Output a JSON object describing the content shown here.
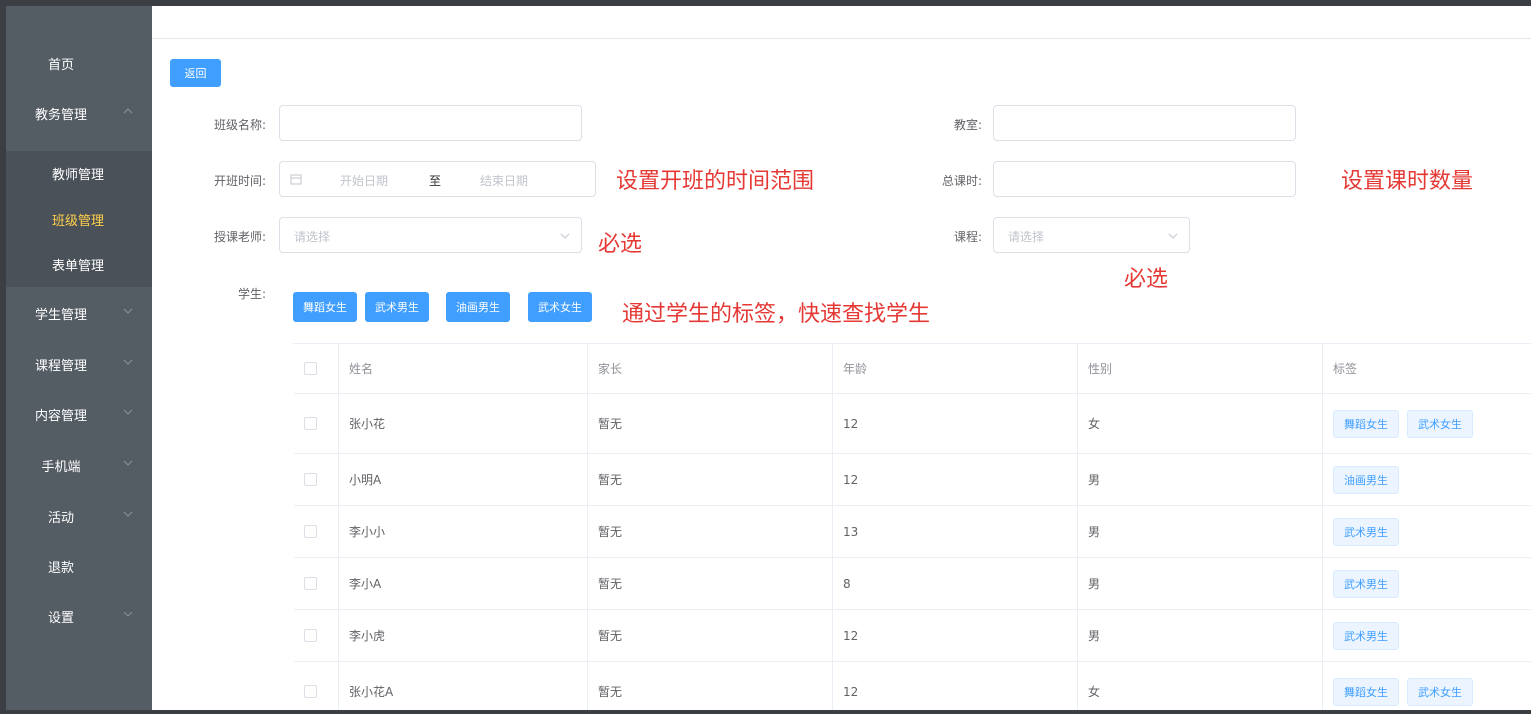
{
  "sidebar": {
    "items": [
      {
        "label": "首页",
        "chevron": false
      },
      {
        "label": "教务管理",
        "chevron": true,
        "expanded": true
      },
      {
        "label": "学生管理",
        "chevron": true
      },
      {
        "label": "课程管理",
        "chevron": true
      },
      {
        "label": "内容管理",
        "chevron": true
      },
      {
        "label": "手机端",
        "chevron": true
      },
      {
        "label": "活动",
        "chevron": true
      },
      {
        "label": "退款",
        "chevron": false
      },
      {
        "label": "设置",
        "chevron": true
      }
    ],
    "submenu": [
      {
        "label": "教师管理",
        "active": false
      },
      {
        "label": "班级管理",
        "active": true
      },
      {
        "label": "表单管理",
        "active": false
      }
    ],
    "colors": {
      "bg": "#545c64",
      "active_text": "#ffd04b"
    }
  },
  "back_button": "返回",
  "form": {
    "class_name_label": "班级名称:",
    "class_name_value": "",
    "classroom_label": "教室:",
    "classroom_value": "",
    "start_time_label": "开班时间:",
    "start_date_placeholder": "开始日期",
    "date_separator": "至",
    "end_date_placeholder": "结束日期",
    "total_hours_label": "总课时:",
    "total_hours_value": "",
    "teacher_label": "授课老师:",
    "teacher_placeholder": "请选择",
    "course_label": "课程:",
    "course_placeholder": "请选择",
    "students_label": "学生:",
    "student_tags": [
      "舞蹈女生",
      "武术男生",
      "油画男生",
      "武术女生"
    ]
  },
  "annotations": {
    "time_range": "设置开班的时间范围",
    "hours": "设置课时数量",
    "teacher_required": "必选",
    "course_required": "必选",
    "tags_hint": "通过学生的标签，快速查找学生",
    "color": "#e53935"
  },
  "table": {
    "headers": [
      "姓名",
      "家长",
      "年龄",
      "性别",
      "标签"
    ],
    "rows": [
      {
        "name": "张小花",
        "parent": "暂无",
        "age": "12",
        "gender": "女",
        "tags": [
          "舞蹈女生",
          "武术女生"
        ]
      },
      {
        "name": "小明A",
        "parent": "暂无",
        "age": "12",
        "gender": "男",
        "tags": [
          "油画男生"
        ]
      },
      {
        "name": "李小小",
        "parent": "暂无",
        "age": "13",
        "gender": "男",
        "tags": [
          "武术男生"
        ]
      },
      {
        "name": "李小A",
        "parent": "暂无",
        "age": "8",
        "gender": "男",
        "tags": [
          "武术男生"
        ]
      },
      {
        "name": "李小虎",
        "parent": "暂无",
        "age": "12",
        "gender": "男",
        "tags": [
          "武术男生"
        ]
      },
      {
        "name": "张小花A",
        "parent": "暂无",
        "age": "12",
        "gender": "女",
        "tags": [
          "舞蹈女生",
          "武术女生"
        ]
      }
    ]
  },
  "accent_color": "#409eff"
}
